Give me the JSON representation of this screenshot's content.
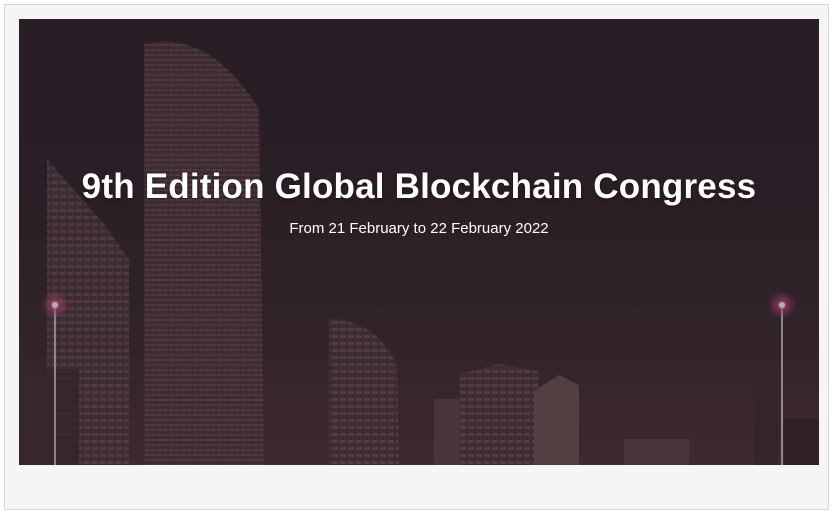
{
  "hero": {
    "title": "9th Edition Global Blockchain Congress",
    "subtitle": "From 21 February to 22 February 2022"
  }
}
